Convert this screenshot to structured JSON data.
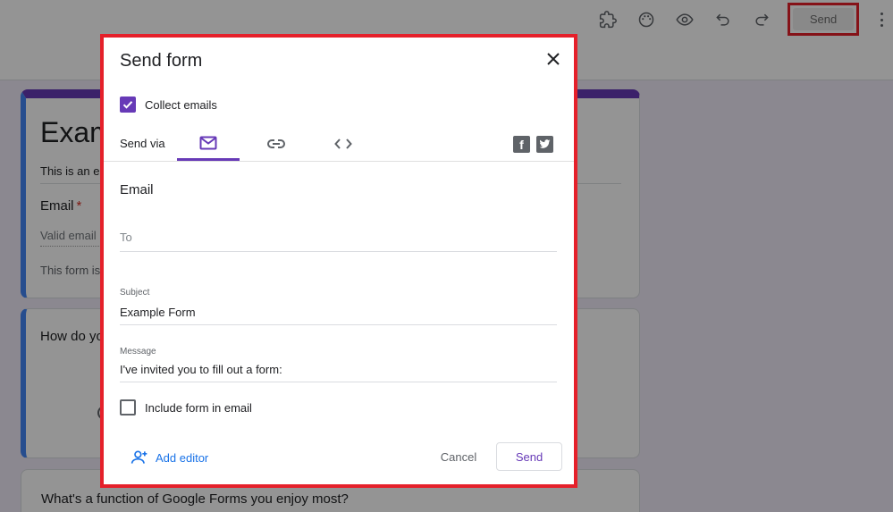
{
  "header": {
    "send_label": "Send",
    "icons": [
      "addons-icon",
      "palette-icon",
      "preview-icon",
      "undo-icon",
      "redo-icon",
      "more-vert-icon"
    ]
  },
  "form": {
    "title": "Exam",
    "description": "This is an e",
    "email_label": "Email",
    "required_mark": "*",
    "email_placeholder": "Valid email",
    "footer_note": "This form is",
    "question1": "How do yo",
    "question2": "What's a function of Google Forms you enjoy most?"
  },
  "dialog": {
    "title": "Send form",
    "collect_emails_label": "Collect emails",
    "collect_emails_checked": true,
    "send_via_label": "Send via",
    "tabs": [
      {
        "name": "email",
        "active": true
      },
      {
        "name": "link",
        "active": false
      },
      {
        "name": "embed",
        "active": false
      }
    ],
    "email_section_label": "Email",
    "to_placeholder": "To",
    "subject_label": "Subject",
    "subject_value": "Example Form",
    "message_label": "Message",
    "message_value": "I've invited you to fill out a form:",
    "include_form_label": "Include form in email",
    "include_form_checked": false,
    "add_editor_label": "Add editor",
    "cancel_label": "Cancel",
    "send_label": "Send"
  },
  "colors": {
    "accent": "#673ab7",
    "highlight": "#e5202a",
    "link": "#1a73e8"
  }
}
